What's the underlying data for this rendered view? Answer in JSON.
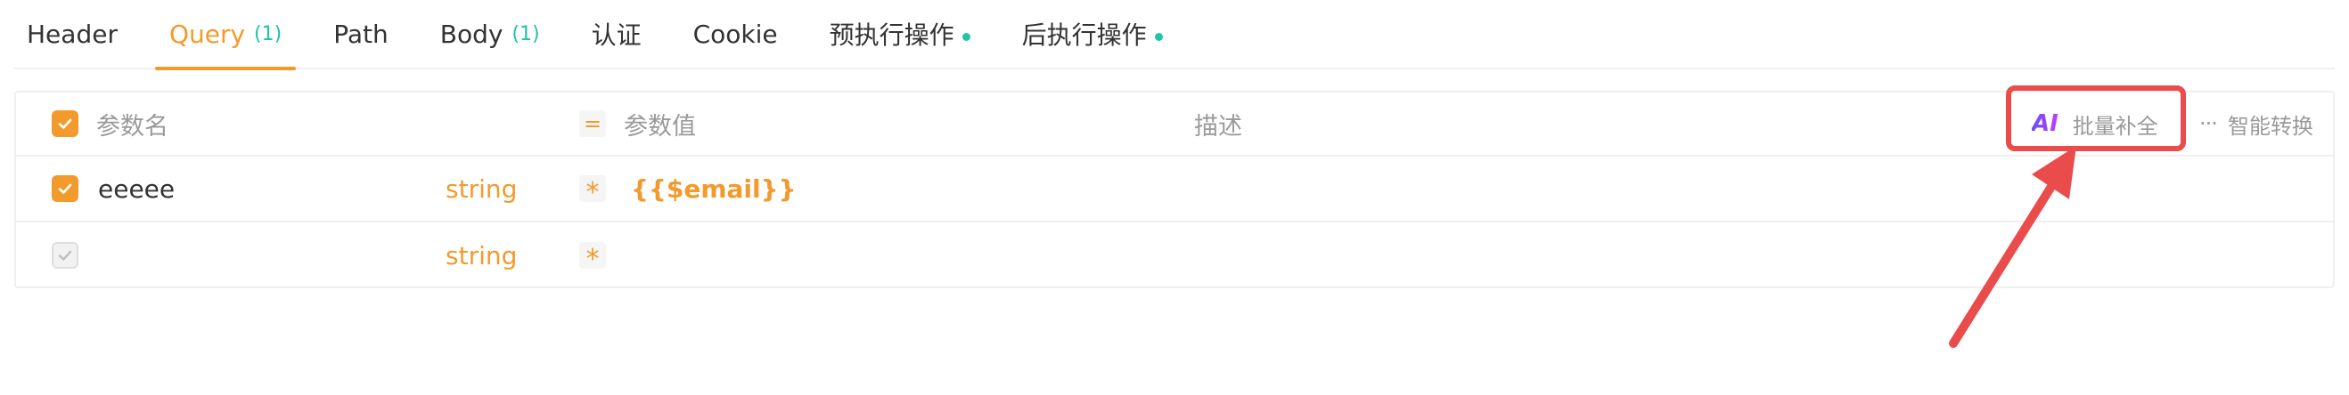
{
  "tabs": [
    {
      "label": "Header",
      "count": "",
      "dot": false,
      "active": false
    },
    {
      "label": "Query",
      "count": "(1)",
      "dot": false,
      "active": true
    },
    {
      "label": "Path",
      "count": "",
      "dot": false,
      "active": false
    },
    {
      "label": "Body",
      "count": "(1)",
      "dot": false,
      "active": false
    },
    {
      "label": "认证",
      "count": "",
      "dot": false,
      "active": false
    },
    {
      "label": "Cookie",
      "count": "",
      "dot": false,
      "active": false
    },
    {
      "label": "预执行操作",
      "count": "",
      "dot": true,
      "active": false
    },
    {
      "label": "后执行操作",
      "count": "",
      "dot": true,
      "active": false
    }
  ],
  "table": {
    "header": {
      "checked": true,
      "name": "参数名",
      "value_badge": "=",
      "value": "参数值",
      "description": "描述",
      "ai_icon": "AI",
      "batch_fill": "批量补全",
      "more_icon": "···",
      "smart_convert": "智能转换"
    },
    "rows": [
      {
        "checked": true,
        "name": "eeeee",
        "type": "string",
        "required_mark": "*",
        "value": "{{$email}}"
      },
      {
        "checked": false,
        "name": "",
        "type": "string",
        "required_mark": "*",
        "value": ""
      }
    ]
  },
  "colors": {
    "accent": "#f39a2c",
    "count": "#1ec5a8",
    "annotation": "#ea4c4c"
  }
}
